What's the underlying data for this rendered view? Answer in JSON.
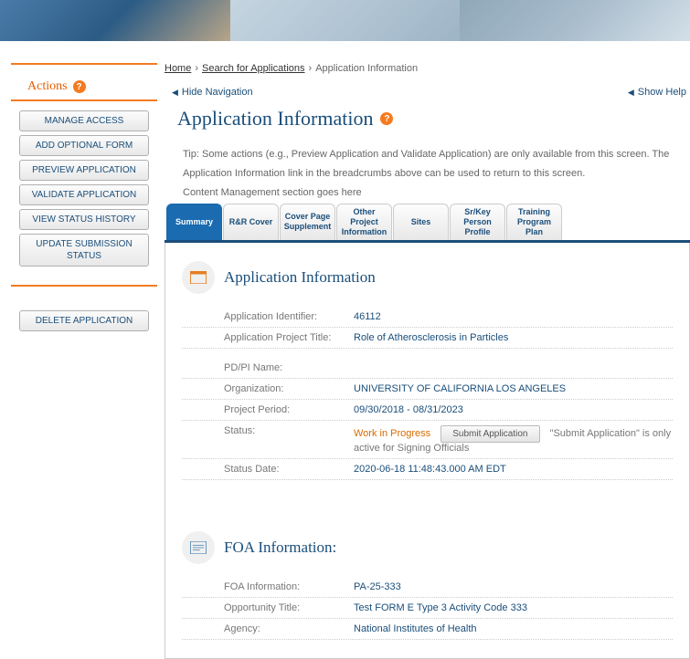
{
  "breadcrumb": {
    "home": "Home",
    "search": "Search for Applications",
    "current": "Application Information"
  },
  "sidebar": {
    "title": "Actions",
    "buttons": [
      "MANAGE ACCESS",
      "ADD OPTIONAL FORM",
      "PREVIEW APPLICATION",
      "VALIDATE APPLICATION",
      "VIEW STATUS HISTORY",
      "UPDATE SUBMISSION STATUS"
    ],
    "delete": "DELETE APPLICATION"
  },
  "nav": {
    "hide": "Hide Navigation",
    "help": "Show Help"
  },
  "heading": "Application Information",
  "tip": "Tip: Some actions (e.g., Preview Application and Validate Application) are only available from this screen. The Application Information link in the breadcrumbs above can be used to return to this screen.",
  "cms": "Content Management section goes here",
  "tabs": [
    "Summary",
    "R&R Cover",
    "Cover Page Supplement",
    "Other Project Information",
    "Sites",
    "Sr/Key Person Profile",
    "Training Program Plan"
  ],
  "appinfo": {
    "title": "Application Information",
    "rows": {
      "id_label": "Application Identifier:",
      "id_value": "46112",
      "proj_label": "Application Project Title:",
      "proj_value": "Role of Atherosclerosis in Particles",
      "pdpi_label": "PD/PI Name:",
      "pdpi_value": "",
      "org_label": "Organization:",
      "org_value": "UNIVERSITY OF CALIFORNIA LOS ANGELES",
      "period_label": "Project Period:",
      "period_value": "09/30/2018 - 08/31/2023",
      "status_label": "Status:",
      "status_value": "Work in Progress",
      "submit_btn": "Submit Application",
      "submit_note": "\"Submit Application\" is only active for Signing Officials",
      "date_label": "Status Date:",
      "date_value": "2020-06-18 11:48:43.000 AM EDT"
    }
  },
  "foa": {
    "title": "FOA Information:",
    "foa_label": "FOA Information:",
    "foa_value": "PA-25-333",
    "opp_label": "Opportunity Title:",
    "opp_value": "Test FORM E Type 3 Activity Code 333",
    "agency_label": "Agency:",
    "agency_value": "National Institutes of Health"
  }
}
